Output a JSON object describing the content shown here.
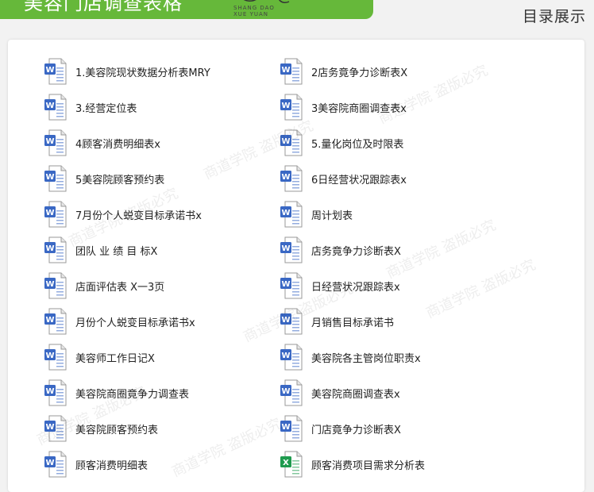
{
  "header": {
    "title": "美容门店调查表格",
    "logo_text": "SHANG DAO\nXUE YUAN",
    "section_label": "目录展示"
  },
  "files": [
    {
      "label": "1.美容院现状数据分析表MRY",
      "type": "word"
    },
    {
      "label": "2店务竟争力诊断表X",
      "type": "word"
    },
    {
      "label": "3.经营定位表",
      "type": "word"
    },
    {
      "label": "3美容院商圈调查表x",
      "type": "word"
    },
    {
      "label": "4顾客消费明细表x",
      "type": "word"
    },
    {
      "label": "5.量化岗位及时限表",
      "type": "word"
    },
    {
      "label": "5美容院顾客预约表",
      "type": "word"
    },
    {
      "label": "6日经营状况跟踪表x",
      "type": "word"
    },
    {
      "label": "7月份个人蜕变目标承诺书x",
      "type": "word"
    },
    {
      "label": "周计划表",
      "type": "word"
    },
    {
      "label": "团队 业 绩 目 标X",
      "type": "word"
    },
    {
      "label": "店务竟争力诊断表X",
      "type": "word"
    },
    {
      "label": "店面评估表 X一3页",
      "type": "word"
    },
    {
      "label": "日经营状况跟踪表x",
      "type": "word"
    },
    {
      "label": "月份个人蜕变目标承诺书x",
      "type": "word"
    },
    {
      "label": "月销售目标承诺书",
      "type": "word"
    },
    {
      "label": "美容师工作日记X",
      "type": "word"
    },
    {
      "label": "美容院各主管岗位职责x",
      "type": "word"
    },
    {
      "label": "美容院商圈竟争力调查表",
      "type": "word"
    },
    {
      "label": "美容院商圈调查表x",
      "type": "word"
    },
    {
      "label": "美容院顾客预约表",
      "type": "word"
    },
    {
      "label": "门店竟争力诊断表X",
      "type": "word"
    },
    {
      "label": "顾客消费明细表",
      "type": "word"
    },
    {
      "label": "顾客消费项目需求分析表",
      "type": "excel"
    }
  ],
  "watermark_text": "商道学院 盗版必究",
  "colors": {
    "banner_green": "#66b83a",
    "word_blue": "#3a68c4",
    "excel_green": "#1e9b4e"
  }
}
